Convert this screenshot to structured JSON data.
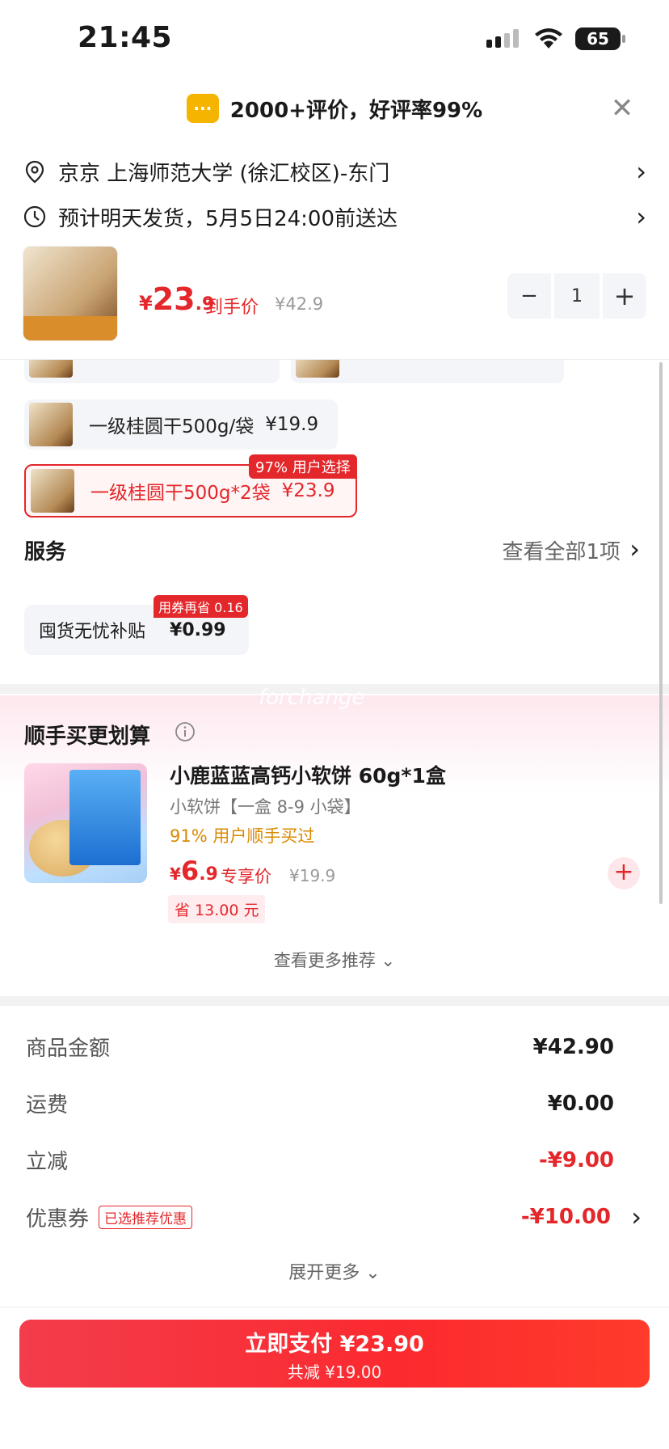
{
  "status_bar": {
    "time": "21:45",
    "battery": "65"
  },
  "review_banner": {
    "icon": "message-icon",
    "text": "2000+评价，好评率99%"
  },
  "address": {
    "text": "京京  上海师范大学 (徐汇校区)-东门"
  },
  "delivery": {
    "text": "预计明天发货，5月5日24:00前送达"
  },
  "product": {
    "currency": "¥",
    "price_int": "23",
    "price_dec": ".9",
    "price_label": "到手价",
    "original_price": "¥42.9",
    "quantity": "1",
    "minus": "−",
    "plus": "+"
  },
  "variants": [
    {
      "label": "一级桂圆干500g/袋",
      "price": "¥19.9",
      "selected": false
    },
    {
      "label": "一级桂圆干500g*2袋",
      "price": "¥23.9",
      "selected": true,
      "tag": "97% 用户选择"
    }
  ],
  "services": {
    "title": "服务",
    "see_all": "查看全部1项",
    "item_label": "囤货无忧补贴",
    "item_price": "¥0.99",
    "item_tag": "用券再省 0.16"
  },
  "watermark": "forchange",
  "recommend": {
    "title": "顺手买更划算",
    "product_title": "小鹿蓝蓝高钙小软饼 60g*1盒",
    "subtitle": "小软饼【一盒 8-9 小袋】",
    "percent_text": "91% 用户顺手买过",
    "currency": "¥",
    "price_int": "6",
    "price_dec": ".9",
    "price_label": "专享价",
    "original_price": "¥19.9",
    "save_text": "省 13.00 元",
    "more": "查看更多推荐"
  },
  "summary": {
    "goods_label": "商品金额",
    "goods_value": "¥42.90",
    "shipping_label": "运费",
    "shipping_value": "¥0.00",
    "discount_label": "立减",
    "discount_value": "-¥9.00",
    "coupon_label": "优惠券",
    "coupon_tag": "已选推荐优惠",
    "coupon_value": "-¥10.00",
    "expand": "展开更多"
  },
  "pay": {
    "main": "立即支付 ¥23.90",
    "sub": "共减 ¥19.00"
  },
  "colors": {
    "accent": "#e4272b",
    "gold": "#f5b400"
  }
}
